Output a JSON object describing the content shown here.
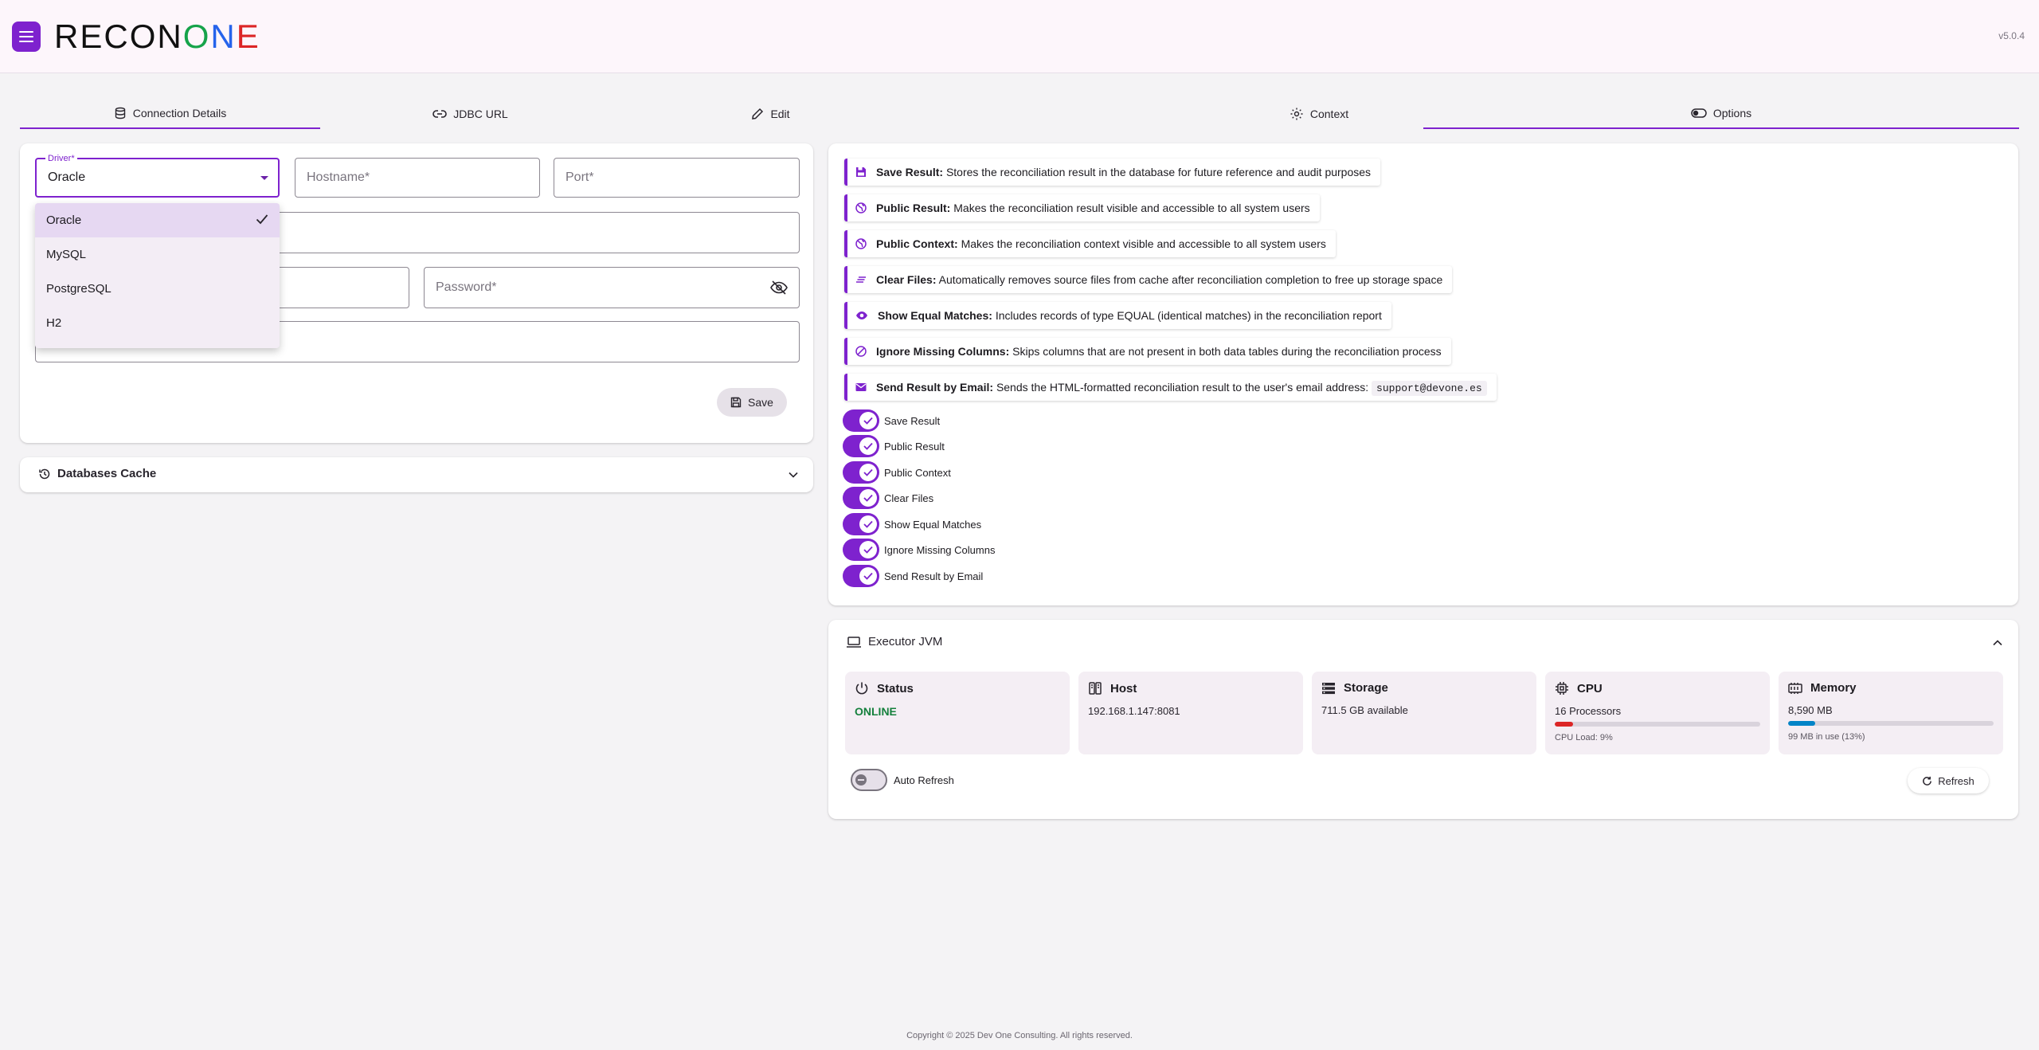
{
  "app": {
    "logo": [
      "R",
      "E",
      "C",
      "O",
      "N",
      "O",
      "N",
      "E"
    ],
    "version": "v5.0.4",
    "footer": "Copyright © 2025 Dev One Consulting. All rights reserved."
  },
  "tabs": [
    {
      "label": "Connection Details",
      "icon": "database-icon",
      "active": true
    },
    {
      "label": "JDBC URL",
      "icon": "link-icon",
      "active": false
    },
    {
      "label": "Edit",
      "icon": "pencil-icon",
      "active": false
    },
    {
      "label": "Context",
      "icon": "gear-context-icon",
      "active": false
    },
    {
      "label": "Options",
      "icon": "toggle-icon",
      "active": true
    }
  ],
  "connection": {
    "driver_label": "Driver*",
    "driver_value": "Oracle",
    "hostname_placeholder": "Hostname*",
    "port_placeholder": "Port*",
    "password_placeholder": "Password*",
    "driver_options": [
      "Oracle",
      "MySQL",
      "PostgreSQL",
      "H2"
    ],
    "selected_driver": "Oracle",
    "save_label": "Save"
  },
  "databases_cache": {
    "title": "Databases Cache"
  },
  "options": [
    {
      "title": "Save Result:",
      "desc": "Stores the reconciliation result in the database for future reference and audit purposes",
      "icon": "save-icon"
    },
    {
      "title": "Public Result:",
      "desc": "Makes the reconciliation result visible and accessible to all system users",
      "icon": "globe-icon"
    },
    {
      "title": "Public Context:",
      "desc": "Makes the reconciliation context visible and accessible to all system users",
      "icon": "globe-icon"
    },
    {
      "title": "Clear Files:",
      "desc": "Automatically removes source files from cache after reconciliation completion to free up storage space",
      "icon": "clear-icon"
    },
    {
      "title": "Show Equal Matches:",
      "desc": "Includes records of type EQUAL (identical matches) in the reconciliation report",
      "icon": "eye-icon"
    },
    {
      "title": "Ignore Missing Columns:",
      "desc": "Skips columns that are not present in both data tables during the reconciliation process",
      "icon": "block-icon"
    },
    {
      "title": "Send Result by Email:",
      "desc": "Sends the HTML-formatted reconciliation result to the user's email address:",
      "code": "support@devone.es",
      "icon": "mail-icon"
    }
  ],
  "toggles": [
    {
      "label": "Save Result",
      "on": true
    },
    {
      "label": "Public Result",
      "on": true
    },
    {
      "label": "Public Context",
      "on": true
    },
    {
      "label": "Clear Files",
      "on": true
    },
    {
      "label": "Show Equal Matches",
      "on": true
    },
    {
      "label": "Ignore Missing Columns",
      "on": true
    },
    {
      "label": "Send Result by Email",
      "on": true
    }
  ],
  "executor": {
    "title": "Executor JVM",
    "status": {
      "label": "Status",
      "value": "ONLINE"
    },
    "host": {
      "label": "Host",
      "value": "192.168.1.147:8081"
    },
    "storage": {
      "label": "Storage",
      "value": "711.5 GB available"
    },
    "cpu": {
      "label": "CPU",
      "value": "16 Processors",
      "sub": "CPU Load: 9%",
      "fraction": 0.09,
      "color": "#dc2626"
    },
    "memory": {
      "label": "Memory",
      "value": "8,590 MB",
      "sub": "99 MB in use (13%)",
      "fraction": 0.13,
      "color": "#0284c7"
    },
    "auto_refresh_label": "Auto Refresh",
    "auto_refresh_on": false,
    "refresh_label": "Refresh"
  },
  "colors": {
    "accent": "#7e22ce",
    "online": "#15803d"
  }
}
